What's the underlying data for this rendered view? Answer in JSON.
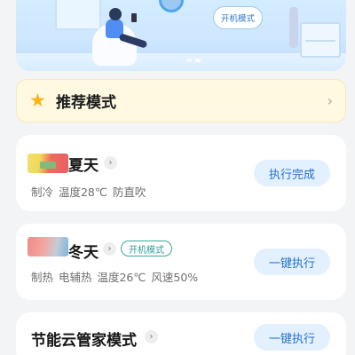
{
  "banner": {
    "mode_bubble": "开机模式",
    "carousel": {
      "count": 2,
      "active_index": 1
    }
  },
  "recommend": {
    "star_icon": "star-icon",
    "label": "推荐模式",
    "chevron_icon": "chevron-right-icon"
  },
  "modes": [
    {
      "title": "夏天",
      "description": "制冷 温度28℃ 防直吹",
      "action": "执行完成",
      "tag": ""
    },
    {
      "title": "冬天",
      "description": "制热 电辅热 温度26℃ 风速50%",
      "action": "一键执行",
      "tag": "开机模式"
    },
    {
      "title": "节能云管家模式",
      "description": "",
      "action": "一键执行",
      "tag": ""
    }
  ],
  "colors": {
    "page_background": "#f3f4f6",
    "accent_blue": "#2572c9",
    "button_background": "#e3f0ff",
    "recommend_background": "#fff9e2",
    "star": "#f6b416",
    "tag_teal": "#2c9d96"
  }
}
